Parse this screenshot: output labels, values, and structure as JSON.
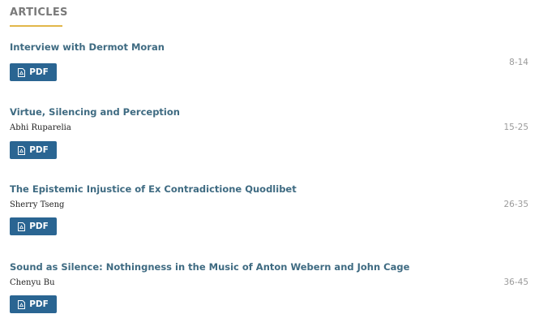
{
  "section": {
    "heading": "ARTICLES"
  },
  "articles": [
    {
      "title": "Interview with Dermot Moran",
      "author": "",
      "pages": "8-14",
      "pdf_label": "PDF"
    },
    {
      "title": "Virtue, Silencing and Perception",
      "author": "Abhi Ruparelia",
      "pages": "15-25",
      "pdf_label": "PDF"
    },
    {
      "title": "The Epistemic Injustice of Ex Contradictione Quodlibet",
      "author": "Sherry Tseng",
      "pages": "26-35",
      "pdf_label": "PDF"
    },
    {
      "title": "Sound as Silence: Nothingness in the Music of Anton Webern and John Cage",
      "author": "Chenyu Bu",
      "pages": "36-45",
      "pdf_label": "PDF"
    }
  ],
  "colors": {
    "accent_underline": "#e2b74a",
    "title_link": "#3f6b82",
    "button_bg": "#2a6592",
    "pages_text": "#9a9a9a"
  },
  "icons": {
    "pdf": "file-pdf-icon"
  }
}
